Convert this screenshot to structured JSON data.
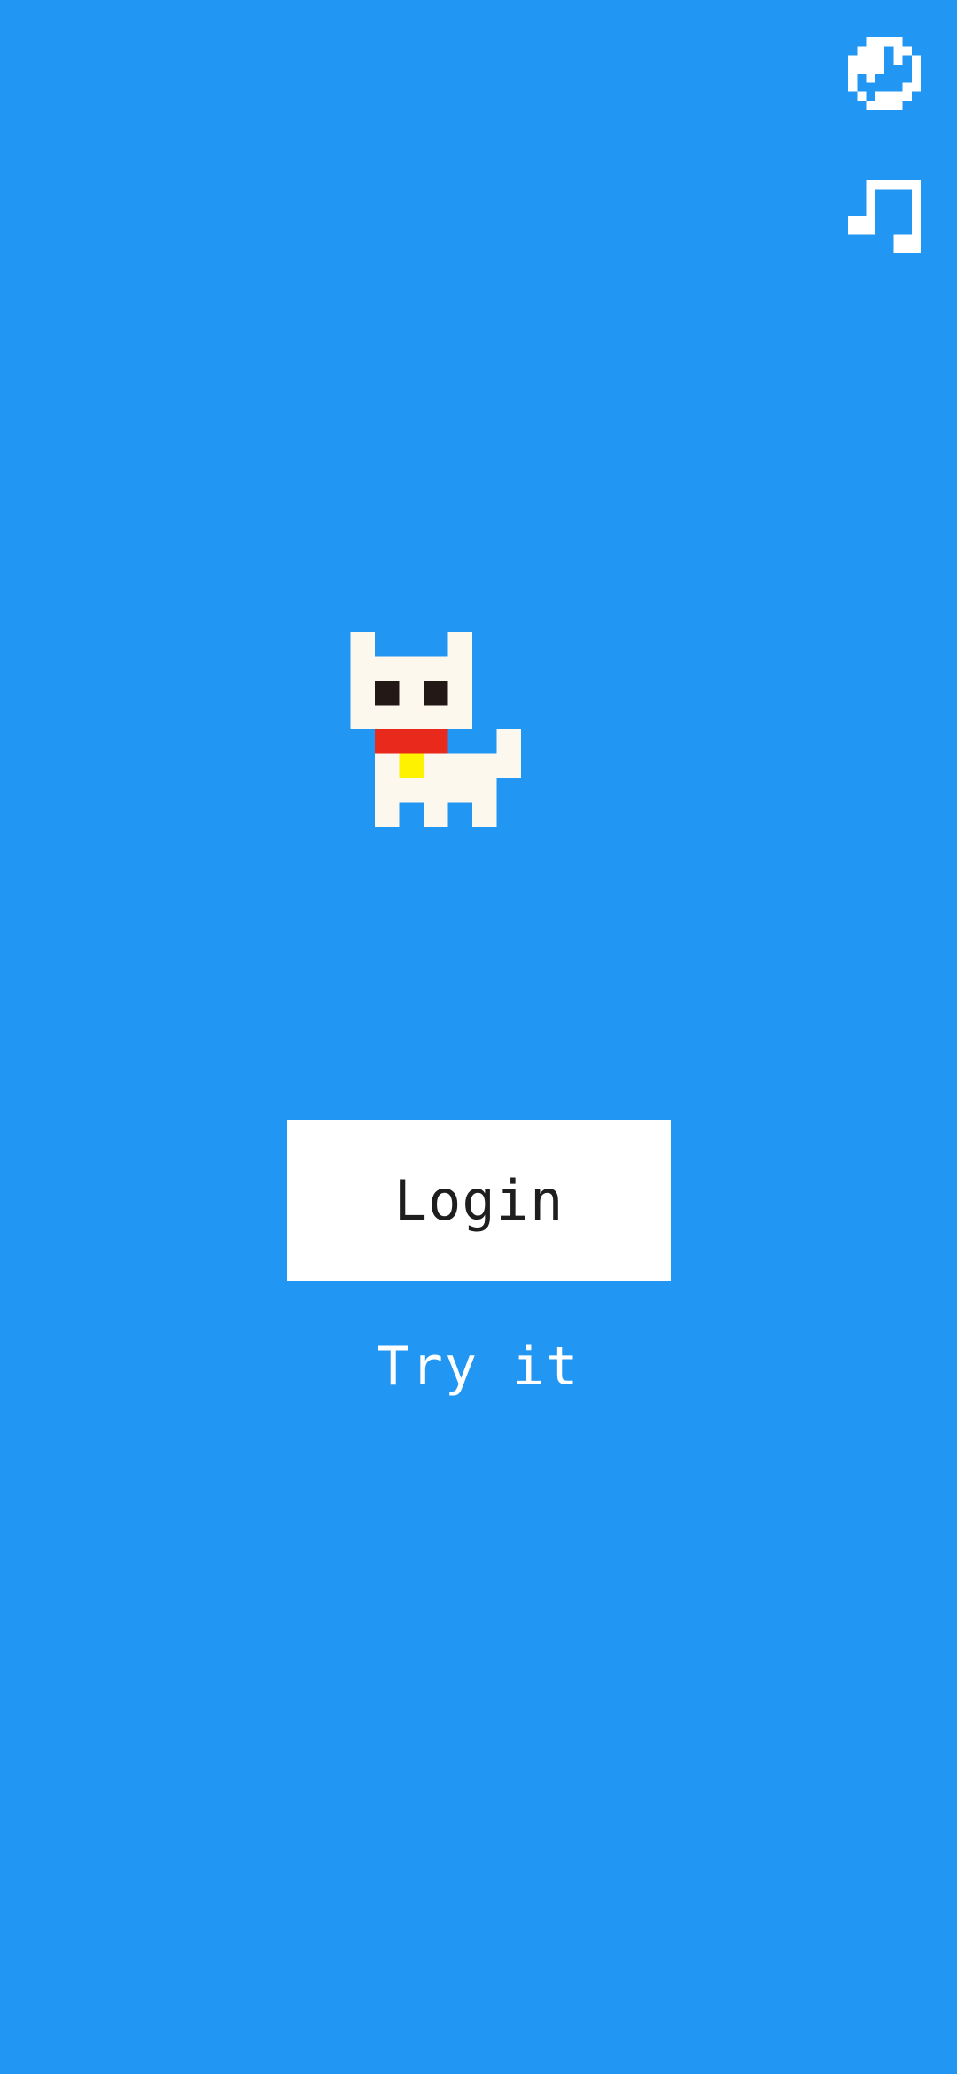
{
  "theme": {
    "background": "#2196F3",
    "button_background": "#FFFFFF",
    "button_text": "#1E1E1E",
    "link_text": "#FFFFFF"
  },
  "header": {
    "icons": [
      {
        "name": "timer-icon",
        "color": "#FFFFFF"
      },
      {
        "name": "music-note-icon",
        "color": "#FFFFFF"
      }
    ]
  },
  "mascot": {
    "name": "pixel-cat",
    "colors": {
      "body": "#FDF8EE",
      "eyes": "#231815",
      "collar": "#E8291C",
      "bell": "#FFF200"
    }
  },
  "main": {
    "login_label": "Login",
    "try_label": "Try it"
  }
}
